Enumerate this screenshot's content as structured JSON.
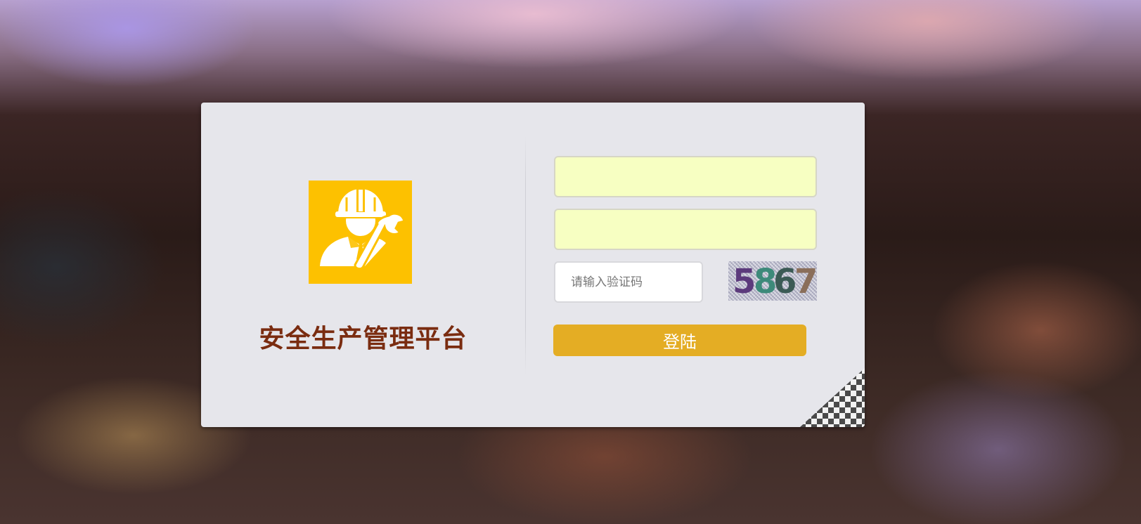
{
  "title": "安全生产管理平台",
  "logo": {
    "icon": "worker-helmet-wrench-icon",
    "background": "#fdc100",
    "foreground": "#ffffff"
  },
  "form": {
    "username": {
      "value": "",
      "placeholder": ""
    },
    "password": {
      "value": "",
      "placeholder": ""
    },
    "captcha": {
      "placeholder": "请输入验证码",
      "code": "5867",
      "digits": [
        "5",
        "8",
        "6",
        "7"
      ],
      "digit_colors": [
        "#5c3a7c",
        "#3d8a7a",
        "#3b5a55",
        "#8a6e5a"
      ]
    },
    "login_button": {
      "label": "登陆",
      "color": "#e4ad24"
    }
  },
  "colors": {
    "title": "#7a2c10",
    "card": "#e6e6eb",
    "input_fill": "#f7ffc2"
  }
}
